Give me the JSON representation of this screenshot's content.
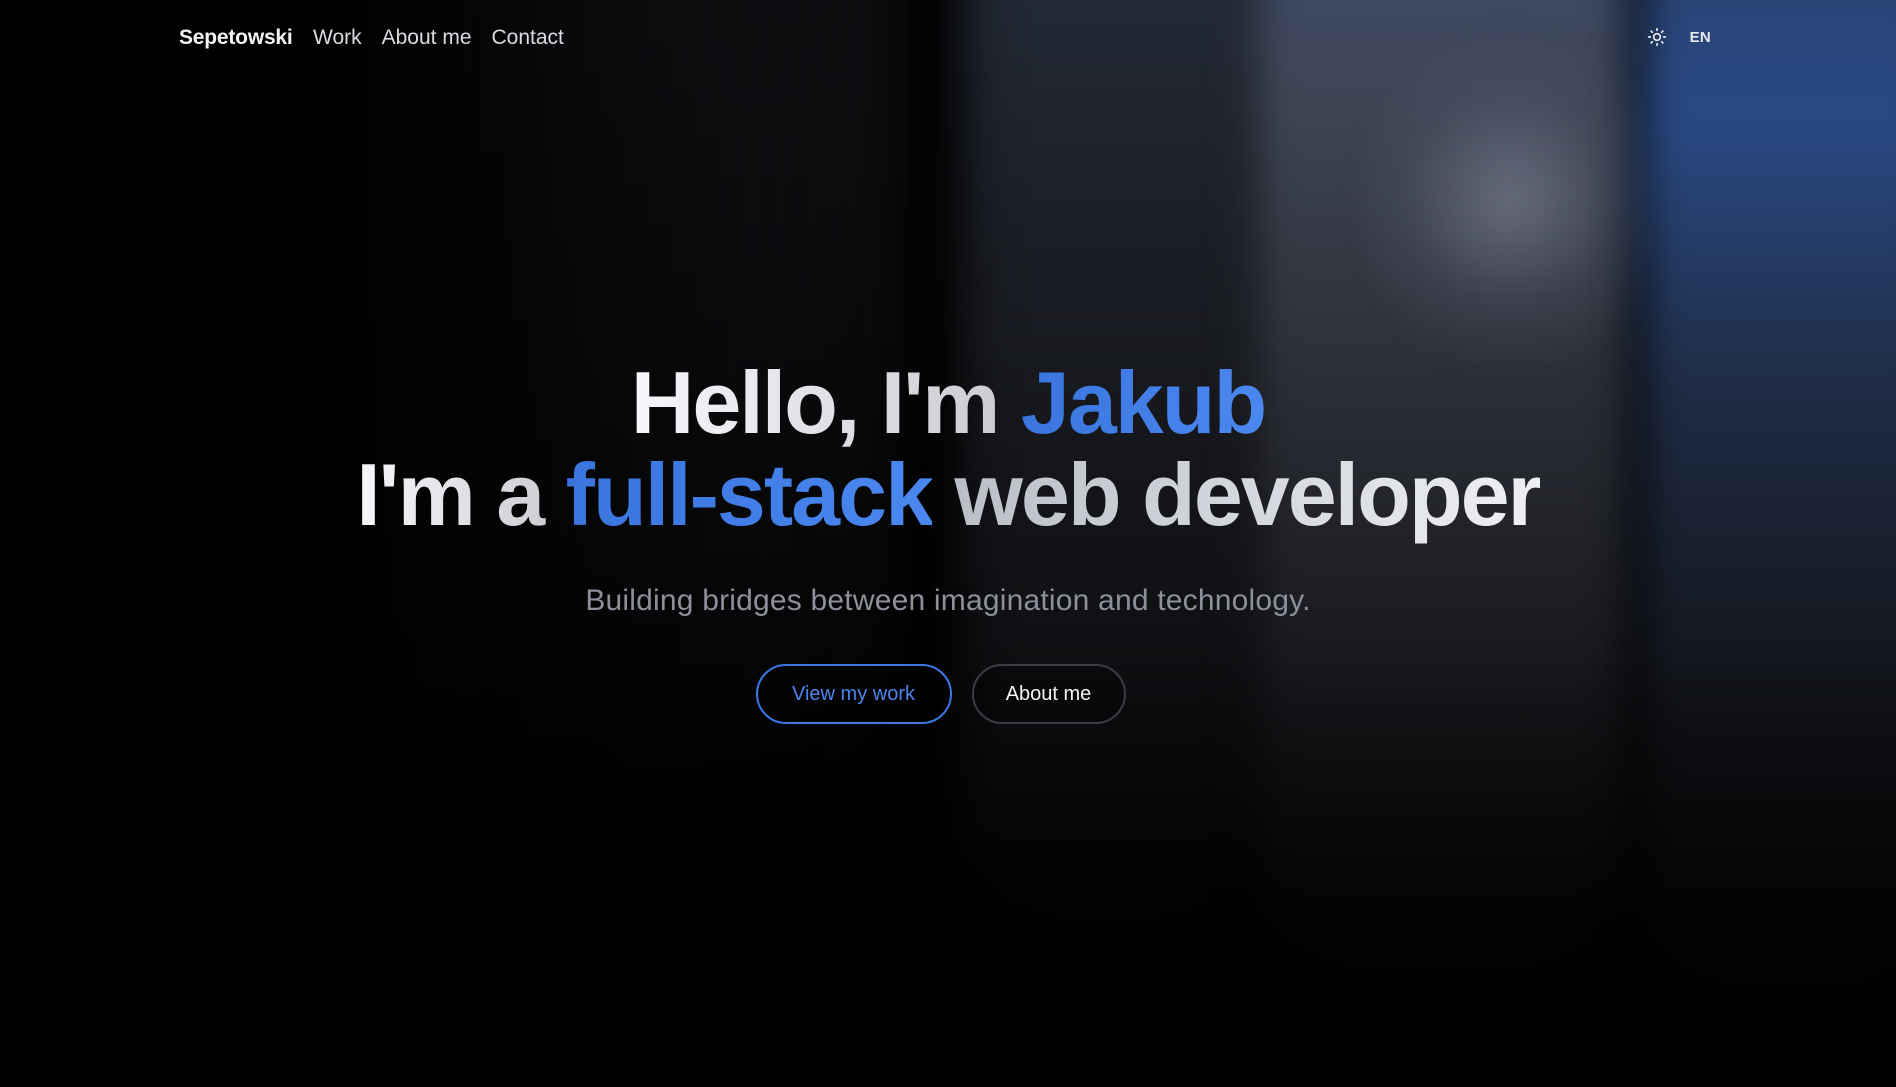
{
  "nav": {
    "brand": "Sepetowski",
    "links": [
      {
        "label": "Work"
      },
      {
        "label": "About me"
      },
      {
        "label": "Contact"
      }
    ],
    "theme_icon": "sun-icon",
    "language": "EN"
  },
  "hero": {
    "line1": {
      "prefix": "Hello, I'm ",
      "name": "Jakub"
    },
    "line2": {
      "prefix": "I'm a ",
      "highlight": "full-stack",
      "suffix": " web developer"
    },
    "tagline": "Building bridges between imagination and technology.",
    "primary_cta": "View my work",
    "secondary_cta": "About me"
  },
  "colors": {
    "accent": "#3b78e6",
    "background": "#000000",
    "text": "#f2f3f6",
    "muted": "#8d909b"
  }
}
